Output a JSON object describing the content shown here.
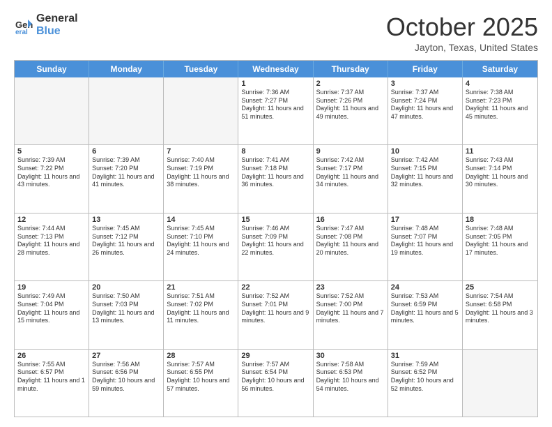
{
  "logo": {
    "general": "General",
    "blue": "Blue"
  },
  "title": "October 2025",
  "location": "Jayton, Texas, United States",
  "days": [
    "Sunday",
    "Monday",
    "Tuesday",
    "Wednesday",
    "Thursday",
    "Friday",
    "Saturday"
  ],
  "weeks": [
    [
      {
        "date": "",
        "info": "",
        "empty": true
      },
      {
        "date": "",
        "info": "",
        "empty": true
      },
      {
        "date": "",
        "info": "",
        "empty": true
      },
      {
        "date": "1",
        "info": "Sunrise: 7:36 AM\nSunset: 7:27 PM\nDaylight: 11 hours\nand 51 minutes.",
        "empty": false
      },
      {
        "date": "2",
        "info": "Sunrise: 7:37 AM\nSunset: 7:26 PM\nDaylight: 11 hours\nand 49 minutes.",
        "empty": false
      },
      {
        "date": "3",
        "info": "Sunrise: 7:37 AM\nSunset: 7:24 PM\nDaylight: 11 hours\nand 47 minutes.",
        "empty": false
      },
      {
        "date": "4",
        "info": "Sunrise: 7:38 AM\nSunset: 7:23 PM\nDaylight: 11 hours\nand 45 minutes.",
        "empty": false
      }
    ],
    [
      {
        "date": "5",
        "info": "Sunrise: 7:39 AM\nSunset: 7:22 PM\nDaylight: 11 hours\nand 43 minutes.",
        "empty": false
      },
      {
        "date": "6",
        "info": "Sunrise: 7:39 AM\nSunset: 7:20 PM\nDaylight: 11 hours\nand 41 minutes.",
        "empty": false
      },
      {
        "date": "7",
        "info": "Sunrise: 7:40 AM\nSunset: 7:19 PM\nDaylight: 11 hours\nand 38 minutes.",
        "empty": false
      },
      {
        "date": "8",
        "info": "Sunrise: 7:41 AM\nSunset: 7:18 PM\nDaylight: 11 hours\nand 36 minutes.",
        "empty": false
      },
      {
        "date": "9",
        "info": "Sunrise: 7:42 AM\nSunset: 7:17 PM\nDaylight: 11 hours\nand 34 minutes.",
        "empty": false
      },
      {
        "date": "10",
        "info": "Sunrise: 7:42 AM\nSunset: 7:15 PM\nDaylight: 11 hours\nand 32 minutes.",
        "empty": false
      },
      {
        "date": "11",
        "info": "Sunrise: 7:43 AM\nSunset: 7:14 PM\nDaylight: 11 hours\nand 30 minutes.",
        "empty": false
      }
    ],
    [
      {
        "date": "12",
        "info": "Sunrise: 7:44 AM\nSunset: 7:13 PM\nDaylight: 11 hours\nand 28 minutes.",
        "empty": false
      },
      {
        "date": "13",
        "info": "Sunrise: 7:45 AM\nSunset: 7:12 PM\nDaylight: 11 hours\nand 26 minutes.",
        "empty": false
      },
      {
        "date": "14",
        "info": "Sunrise: 7:45 AM\nSunset: 7:10 PM\nDaylight: 11 hours\nand 24 minutes.",
        "empty": false
      },
      {
        "date": "15",
        "info": "Sunrise: 7:46 AM\nSunset: 7:09 PM\nDaylight: 11 hours\nand 22 minutes.",
        "empty": false
      },
      {
        "date": "16",
        "info": "Sunrise: 7:47 AM\nSunset: 7:08 PM\nDaylight: 11 hours\nand 20 minutes.",
        "empty": false
      },
      {
        "date": "17",
        "info": "Sunrise: 7:48 AM\nSunset: 7:07 PM\nDaylight: 11 hours\nand 19 minutes.",
        "empty": false
      },
      {
        "date": "18",
        "info": "Sunrise: 7:48 AM\nSunset: 7:05 PM\nDaylight: 11 hours\nand 17 minutes.",
        "empty": false
      }
    ],
    [
      {
        "date": "19",
        "info": "Sunrise: 7:49 AM\nSunset: 7:04 PM\nDaylight: 11 hours\nand 15 minutes.",
        "empty": false
      },
      {
        "date": "20",
        "info": "Sunrise: 7:50 AM\nSunset: 7:03 PM\nDaylight: 11 hours\nand 13 minutes.",
        "empty": false
      },
      {
        "date": "21",
        "info": "Sunrise: 7:51 AM\nSunset: 7:02 PM\nDaylight: 11 hours\nand 11 minutes.",
        "empty": false
      },
      {
        "date": "22",
        "info": "Sunrise: 7:52 AM\nSunset: 7:01 PM\nDaylight: 11 hours\nand 9 minutes.",
        "empty": false
      },
      {
        "date": "23",
        "info": "Sunrise: 7:52 AM\nSunset: 7:00 PM\nDaylight: 11 hours\nand 7 minutes.",
        "empty": false
      },
      {
        "date": "24",
        "info": "Sunrise: 7:53 AM\nSunset: 6:59 PM\nDaylight: 11 hours\nand 5 minutes.",
        "empty": false
      },
      {
        "date": "25",
        "info": "Sunrise: 7:54 AM\nSunset: 6:58 PM\nDaylight: 11 hours\nand 3 minutes.",
        "empty": false
      }
    ],
    [
      {
        "date": "26",
        "info": "Sunrise: 7:55 AM\nSunset: 6:57 PM\nDaylight: 11 hours\nand 1 minute.",
        "empty": false
      },
      {
        "date": "27",
        "info": "Sunrise: 7:56 AM\nSunset: 6:56 PM\nDaylight: 10 hours\nand 59 minutes.",
        "empty": false
      },
      {
        "date": "28",
        "info": "Sunrise: 7:57 AM\nSunset: 6:55 PM\nDaylight: 10 hours\nand 57 minutes.",
        "empty": false
      },
      {
        "date": "29",
        "info": "Sunrise: 7:57 AM\nSunset: 6:54 PM\nDaylight: 10 hours\nand 56 minutes.",
        "empty": false
      },
      {
        "date": "30",
        "info": "Sunrise: 7:58 AM\nSunset: 6:53 PM\nDaylight: 10 hours\nand 54 minutes.",
        "empty": false
      },
      {
        "date": "31",
        "info": "Sunrise: 7:59 AM\nSunset: 6:52 PM\nDaylight: 10 hours\nand 52 minutes.",
        "empty": false
      },
      {
        "date": "",
        "info": "",
        "empty": true
      }
    ]
  ]
}
